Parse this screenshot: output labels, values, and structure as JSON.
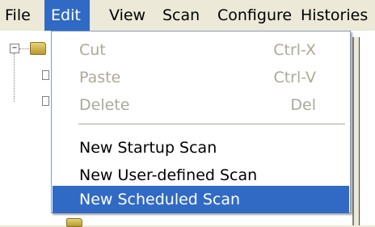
{
  "menubar": {
    "items": [
      {
        "label": "File"
      },
      {
        "label": "Edit"
      },
      {
        "label": "View"
      },
      {
        "label": "Scan"
      },
      {
        "label": "Configure"
      },
      {
        "label": "Histories"
      }
    ]
  },
  "edit_menu": {
    "cut": {
      "label": "Cut",
      "shortcut": "Ctrl-X"
    },
    "paste": {
      "label": "Paste",
      "shortcut": "Ctrl-V"
    },
    "delete": {
      "label": "Delete",
      "shortcut": "Del"
    },
    "new_startup_scan": {
      "label": "New Startup Scan"
    },
    "new_user_defined_scan": {
      "label": "New User-defined Scan"
    },
    "new_scheduled_scan": {
      "label": "New Scheduled Scan"
    }
  },
  "colors": {
    "menu_background": "#ece9d8",
    "highlight": "#316ac5",
    "highlight_text": "#ffffff",
    "disabled_text": "#aca899"
  },
  "icons": {
    "tree_expander": "minus-box-icon",
    "tree_folder": "folder-icon"
  }
}
